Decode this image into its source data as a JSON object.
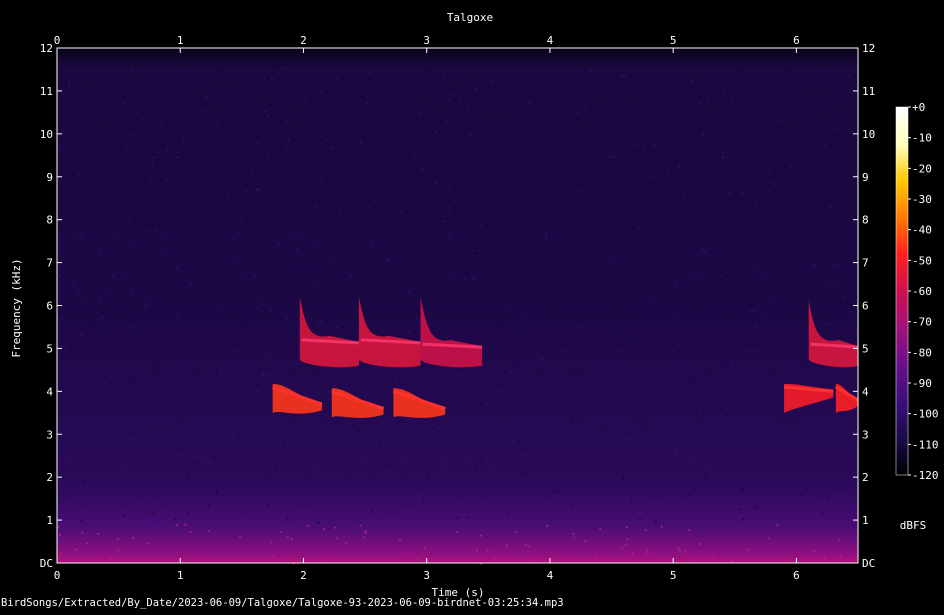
{
  "chart_data": {
    "type": "heatmap",
    "title": "Talgoxe",
    "xlabel": "Time (s)",
    "ylabel": "Frequency (kHz)",
    "xlim": [
      0,
      6.5
    ],
    "ylim": [
      0,
      12
    ],
    "x_ticks": [
      "0",
      "1",
      "2",
      "3",
      "4",
      "5",
      "6"
    ],
    "y_ticks": [
      "DC",
      "1",
      "2",
      "3",
      "4",
      "5",
      "6",
      "7",
      "8",
      "9",
      "10",
      "11",
      "12"
    ],
    "colorbar": {
      "unit": "dBFS",
      "range": [
        -120,
        0
      ],
      "ticks": [
        "+0",
        "-10",
        "-20",
        "-30",
        "-40",
        "-50",
        "-60",
        "-70",
        "-80",
        "-90",
        "-100",
        "-110",
        "-120"
      ],
      "colors": [
        "#000000",
        "#1a0a4a",
        "#3a0f7a",
        "#6a0f8a",
        "#a0107a",
        "#d01050",
        "#ff2020",
        "#ff7a00",
        "#ffc800",
        "#ffffc0",
        "#ffffff"
      ]
    },
    "calls": [
      {
        "kind": "sweep",
        "t0": 1.75,
        "t1": 2.15,
        "f_start": 4.1,
        "f_end": 3.7,
        "level": -45
      },
      {
        "kind": "hump",
        "t0": 1.97,
        "t1": 2.45,
        "f_top": 6.2,
        "f_peak": 5.2,
        "f_bottom": 4.6,
        "level": -55
      },
      {
        "kind": "sweep",
        "t0": 2.23,
        "t1": 2.65,
        "f_start": 4.0,
        "f_end": 3.6,
        "level": -45
      },
      {
        "kind": "hump",
        "t0": 2.45,
        "t1": 2.95,
        "f_top": 6.2,
        "f_peak": 5.2,
        "f_bottom": 4.6,
        "level": -55
      },
      {
        "kind": "sweep",
        "t0": 2.73,
        "t1": 3.15,
        "f_start": 4.0,
        "f_end": 3.6,
        "level": -45
      },
      {
        "kind": "hump",
        "t0": 2.95,
        "t1": 3.45,
        "f_top": 6.2,
        "f_peak": 5.1,
        "f_bottom": 4.6,
        "level": -58
      },
      {
        "kind": "sweep",
        "t0": 5.9,
        "t1": 6.3,
        "f_start": 4.1,
        "f_end": 4.0,
        "level": -50
      },
      {
        "kind": "hump",
        "t0": 6.1,
        "t1": 6.5,
        "f_top": 6.1,
        "f_peak": 5.1,
        "f_bottom": 4.6,
        "level": -55
      },
      {
        "kind": "sweep",
        "t0": 6.32,
        "t1": 6.5,
        "f_start": 4.1,
        "f_end": 3.8,
        "level": -48
      }
    ]
  },
  "footer": {
    "path": "BirdSongs/Extracted/By_Date/2023-06-09/Talgoxe/Talgoxe-93-2023-06-09-birdnet-03:25:34.mp3"
  }
}
